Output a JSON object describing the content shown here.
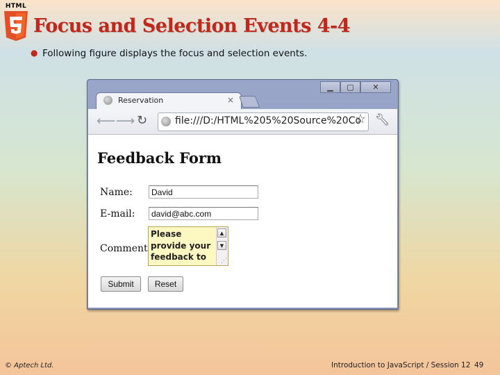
{
  "slide": {
    "logo_text": "HTML",
    "title": "Focus and Selection Events 4-4",
    "bullet": "Following figure displays the focus and selection events.",
    "footer_left": "© Aptech Ltd.",
    "footer_right": "Introduction to JavaScript / Session 12",
    "page_number": "49"
  },
  "browser": {
    "tab_title": "Reservation",
    "tab_close": "×",
    "url": "file:///D:/HTML%205%20Source%20Co",
    "controls": {
      "minimize": "▁",
      "maximize": "▢",
      "close": "✕"
    },
    "icons": [
      "back-arrow-icon",
      "forward-arrow-icon",
      "reload-icon",
      "page-icon",
      "star-icon",
      "wrench-icon"
    ]
  },
  "form": {
    "title": "Feedback Form",
    "name_label": "Name:",
    "name_value": "David",
    "email_label": "E-mail:",
    "email_value": "david@abc.com",
    "comment_label": "Comment:",
    "comment_value": "Please provide your feedback to",
    "submit_label": "Submit",
    "reset_label": "Reset"
  },
  "colors": {
    "title": "#c0281c",
    "comment_bg": "#fdf7c2",
    "window_frame": "#8893b8"
  }
}
